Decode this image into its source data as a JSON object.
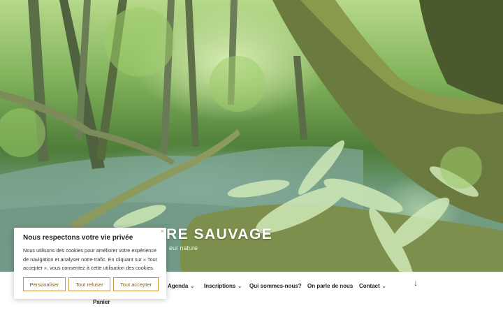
{
  "hero": {
    "site_title_visible": "RE SAUVAGE",
    "site_description_visible": "eur nature"
  },
  "cookie_banner": {
    "title": "Nous respectons votre vie privée",
    "text": "Nous utilisons des cookies pour améliorer votre expérience de navigation et analyser notre trafic. En cliquant sur « Tout accepter », vous consentez à cette utilisation des cookies.",
    "close_label": "×",
    "buttons": {
      "customize": "Personaliser",
      "refuse": "Tout refuser",
      "accept": "Tout accepter"
    },
    "accent_color": "#c8923a"
  },
  "nav": {
    "items": [
      {
        "label": "Agenda",
        "has_dropdown": true
      },
      {
        "label": "Inscriptions",
        "has_dropdown": true
      },
      {
        "label": "Qui sommes-nous?",
        "has_dropdown": false
      },
      {
        "label": "On parle de nous",
        "has_dropdown": false
      },
      {
        "label": "Contact",
        "has_dropdown": true
      }
    ],
    "dropdown_glyph": "⌄",
    "scroll_glyph": "↓",
    "second_row_item": "Panier"
  }
}
